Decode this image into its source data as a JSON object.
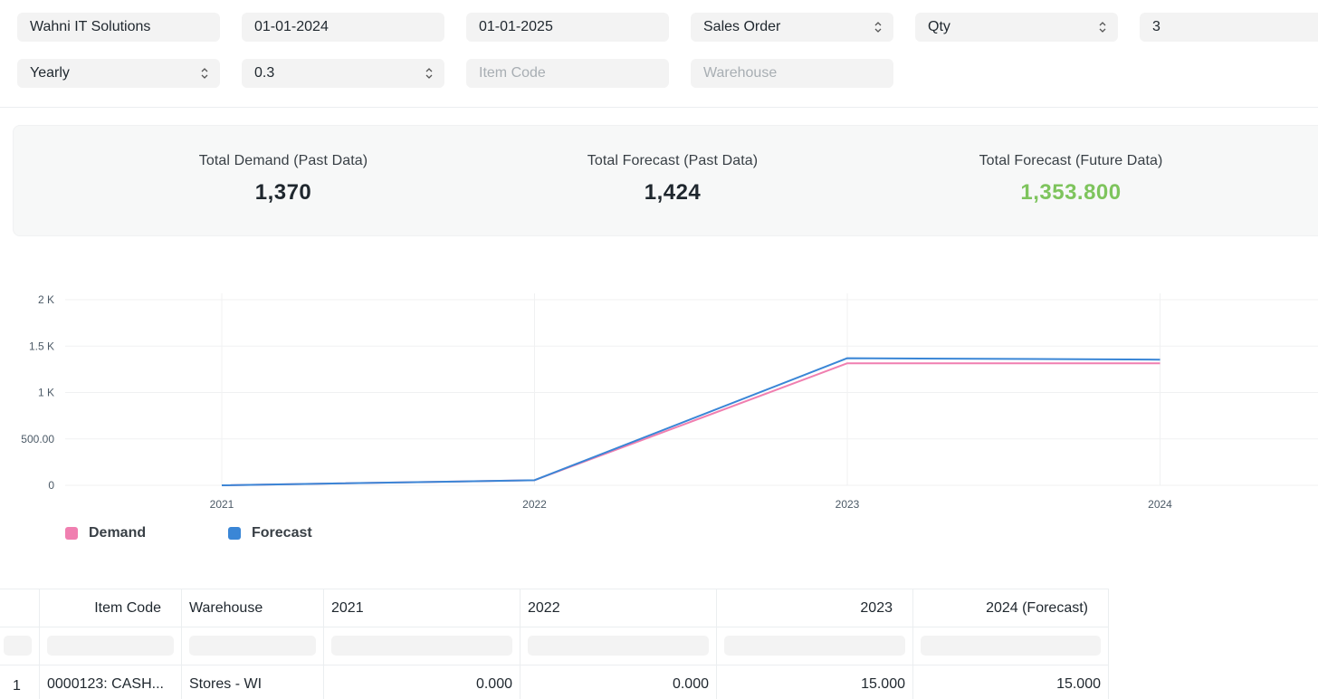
{
  "filters": {
    "company": "Wahni IT Solutions",
    "from_date": "01-01-2024",
    "to_date": "01-01-2025",
    "based_on_document": "Sales Order",
    "based_on_field": "Qty",
    "no_of_years": "3",
    "periodicity": "Yearly",
    "smoothing_constant": "0.3",
    "item_code_placeholder": "Item Code",
    "warehouse_placeholder": "Warehouse"
  },
  "summary": [
    {
      "label": "Total Demand (Past Data)",
      "value": "1,370"
    },
    {
      "label": "Total Forecast (Past Data)",
      "value": "1,424"
    },
    {
      "label": "Total Forecast (Future Data)",
      "value": "1,353.800"
    }
  ],
  "colors": {
    "demand": "#f07fb0",
    "forecast": "#3a86d6",
    "future_value": "#7ec45d"
  },
  "chart_data": {
    "type": "line",
    "categories": [
      "2021",
      "2022",
      "2023",
      "2024"
    ],
    "series": [
      {
        "name": "Demand",
        "values": [
          0,
          55,
          1315,
          1315
        ]
      },
      {
        "name": "Forecast",
        "values": [
          0,
          55,
          1370,
          1354
        ]
      }
    ],
    "y_ticks": [
      "0",
      "500.00",
      "1 K",
      "1.5 K",
      "2 K"
    ],
    "ylim": [
      0,
      2000
    ],
    "grid": true,
    "legend_position": "bottom-left"
  },
  "table": {
    "columns": [
      "",
      "Item Code",
      "Warehouse",
      "2021",
      "2022",
      "2023",
      "2024 (Forecast)"
    ],
    "rows": [
      [
        "1",
        "0000123: CASH...",
        "Stores - WI",
        "0.000",
        "0.000",
        "15.000",
        "15.000"
      ]
    ]
  }
}
